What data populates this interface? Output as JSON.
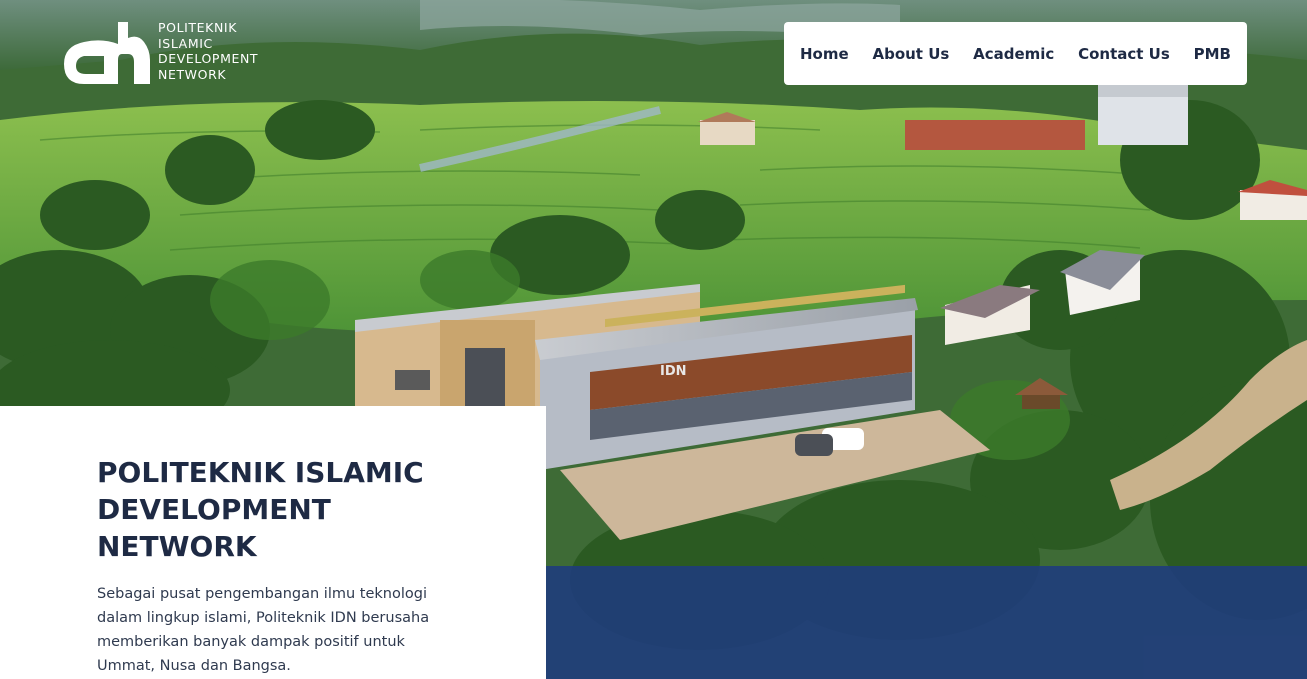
{
  "logo": {
    "lines": [
      "POLITEKNIK",
      "ISLAMIC",
      "DEVELOPMENT",
      "NETWORK"
    ]
  },
  "nav": {
    "items": [
      {
        "label": "Home"
      },
      {
        "label": "About Us"
      },
      {
        "label": "Academic"
      },
      {
        "label": "Contact Us"
      },
      {
        "label": "PMB"
      }
    ]
  },
  "hero": {
    "title": "POLITEKNIK ISLAMIC DEVELOPMENT NETWORK",
    "description": "Sebagai pusat pengembangan ilmu teknologi dalam lingkup islami, Politeknik IDN berusaha memberikan banyak dampak positif untuk Ummat, Nusa dan Bangsa.",
    "building_sign": "IDN"
  },
  "colors": {
    "heading": "#1e2a44",
    "accent_blue": "#1e3a80",
    "field_green": "#5b9e3a",
    "forest_green": "#2f5a22"
  }
}
